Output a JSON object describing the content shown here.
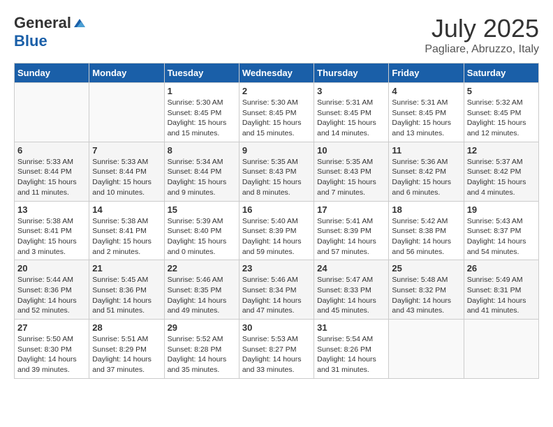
{
  "logo": {
    "general": "General",
    "blue": "Blue"
  },
  "title": {
    "month": "July 2025",
    "location": "Pagliare, Abruzzo, Italy"
  },
  "weekdays": [
    "Sunday",
    "Monday",
    "Tuesday",
    "Wednesday",
    "Thursday",
    "Friday",
    "Saturday"
  ],
  "rows": [
    [
      {
        "day": "",
        "info": ""
      },
      {
        "day": "",
        "info": ""
      },
      {
        "day": "1",
        "info": "Sunrise: 5:30 AM\nSunset: 8:45 PM\nDaylight: 15 hours and 15 minutes."
      },
      {
        "day": "2",
        "info": "Sunrise: 5:30 AM\nSunset: 8:45 PM\nDaylight: 15 hours and 15 minutes."
      },
      {
        "day": "3",
        "info": "Sunrise: 5:31 AM\nSunset: 8:45 PM\nDaylight: 15 hours and 14 minutes."
      },
      {
        "day": "4",
        "info": "Sunrise: 5:31 AM\nSunset: 8:45 PM\nDaylight: 15 hours and 13 minutes."
      },
      {
        "day": "5",
        "info": "Sunrise: 5:32 AM\nSunset: 8:45 PM\nDaylight: 15 hours and 12 minutes."
      }
    ],
    [
      {
        "day": "6",
        "info": "Sunrise: 5:33 AM\nSunset: 8:44 PM\nDaylight: 15 hours and 11 minutes."
      },
      {
        "day": "7",
        "info": "Sunrise: 5:33 AM\nSunset: 8:44 PM\nDaylight: 15 hours and 10 minutes."
      },
      {
        "day": "8",
        "info": "Sunrise: 5:34 AM\nSunset: 8:44 PM\nDaylight: 15 hours and 9 minutes."
      },
      {
        "day": "9",
        "info": "Sunrise: 5:35 AM\nSunset: 8:43 PM\nDaylight: 15 hours and 8 minutes."
      },
      {
        "day": "10",
        "info": "Sunrise: 5:35 AM\nSunset: 8:43 PM\nDaylight: 15 hours and 7 minutes."
      },
      {
        "day": "11",
        "info": "Sunrise: 5:36 AM\nSunset: 8:42 PM\nDaylight: 15 hours and 6 minutes."
      },
      {
        "day": "12",
        "info": "Sunrise: 5:37 AM\nSunset: 8:42 PM\nDaylight: 15 hours and 4 minutes."
      }
    ],
    [
      {
        "day": "13",
        "info": "Sunrise: 5:38 AM\nSunset: 8:41 PM\nDaylight: 15 hours and 3 minutes."
      },
      {
        "day": "14",
        "info": "Sunrise: 5:38 AM\nSunset: 8:41 PM\nDaylight: 15 hours and 2 minutes."
      },
      {
        "day": "15",
        "info": "Sunrise: 5:39 AM\nSunset: 8:40 PM\nDaylight: 15 hours and 0 minutes."
      },
      {
        "day": "16",
        "info": "Sunrise: 5:40 AM\nSunset: 8:39 PM\nDaylight: 14 hours and 59 minutes."
      },
      {
        "day": "17",
        "info": "Sunrise: 5:41 AM\nSunset: 8:39 PM\nDaylight: 14 hours and 57 minutes."
      },
      {
        "day": "18",
        "info": "Sunrise: 5:42 AM\nSunset: 8:38 PM\nDaylight: 14 hours and 56 minutes."
      },
      {
        "day": "19",
        "info": "Sunrise: 5:43 AM\nSunset: 8:37 PM\nDaylight: 14 hours and 54 minutes."
      }
    ],
    [
      {
        "day": "20",
        "info": "Sunrise: 5:44 AM\nSunset: 8:36 PM\nDaylight: 14 hours and 52 minutes."
      },
      {
        "day": "21",
        "info": "Sunrise: 5:45 AM\nSunset: 8:36 PM\nDaylight: 14 hours and 51 minutes."
      },
      {
        "day": "22",
        "info": "Sunrise: 5:46 AM\nSunset: 8:35 PM\nDaylight: 14 hours and 49 minutes."
      },
      {
        "day": "23",
        "info": "Sunrise: 5:46 AM\nSunset: 8:34 PM\nDaylight: 14 hours and 47 minutes."
      },
      {
        "day": "24",
        "info": "Sunrise: 5:47 AM\nSunset: 8:33 PM\nDaylight: 14 hours and 45 minutes."
      },
      {
        "day": "25",
        "info": "Sunrise: 5:48 AM\nSunset: 8:32 PM\nDaylight: 14 hours and 43 minutes."
      },
      {
        "day": "26",
        "info": "Sunrise: 5:49 AM\nSunset: 8:31 PM\nDaylight: 14 hours and 41 minutes."
      }
    ],
    [
      {
        "day": "27",
        "info": "Sunrise: 5:50 AM\nSunset: 8:30 PM\nDaylight: 14 hours and 39 minutes."
      },
      {
        "day": "28",
        "info": "Sunrise: 5:51 AM\nSunset: 8:29 PM\nDaylight: 14 hours and 37 minutes."
      },
      {
        "day": "29",
        "info": "Sunrise: 5:52 AM\nSunset: 8:28 PM\nDaylight: 14 hours and 35 minutes."
      },
      {
        "day": "30",
        "info": "Sunrise: 5:53 AM\nSunset: 8:27 PM\nDaylight: 14 hours and 33 minutes."
      },
      {
        "day": "31",
        "info": "Sunrise: 5:54 AM\nSunset: 8:26 PM\nDaylight: 14 hours and 31 minutes."
      },
      {
        "day": "",
        "info": ""
      },
      {
        "day": "",
        "info": ""
      }
    ]
  ]
}
